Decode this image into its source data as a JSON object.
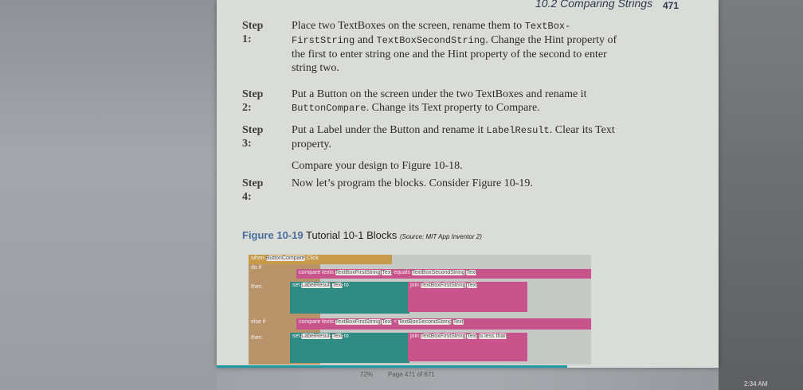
{
  "header": {
    "section": "10.2 Comparing Strings",
    "page": "471"
  },
  "steps": [
    {
      "label": "Step 1:",
      "parts": [
        "Place two TextBoxes on the screen, rename them to ",
        "TextBox-FirstString",
        " and ",
        "TextBoxSecondString",
        ". Change the Hint property of the first to enter string one and the Hint property of the second to enter string two."
      ]
    },
    {
      "label": "Step 2:",
      "parts": [
        "Put a Button on the screen under the two TextBoxes and rename it ",
        "ButtonCompare",
        ". Change its Text property to Compare."
      ]
    },
    {
      "label": "Step 3:",
      "parts": [
        "Put a Label under the Button and rename it ",
        "LabelResult",
        ". Clear its Text property."
      ]
    },
    {
      "label": "",
      "parts": [
        "Compare your design to Figure 10-18."
      ]
    },
    {
      "label": "Step 4:",
      "parts": [
        "Now let’s program the blocks. Consider Figure 10-19."
      ]
    }
  ],
  "figure": {
    "number": "Figure 10-19",
    "title": "Tutorial 10-1 Blocks",
    "source": "(Source: MIT App Inventor 2)"
  },
  "blocks": {
    "when": "when",
    "button": "ButtonCompare",
    "click": "Click",
    "do": "do",
    "if": "if",
    "then": "then",
    "else_if": "else if",
    "compare": "compare texts",
    "first": "TextBoxFirstString",
    "second": "TextBoxSecondString",
    "text": "Text",
    "set": "set",
    "label": "LabelResult",
    "to": "to",
    "join": "join",
    "equals": "equals",
    "lt": "<",
    "less_than": "is less than"
  },
  "status": {
    "zoom": "72%",
    "page": "Page 471 of 671"
  },
  "clock": "2:34 AM"
}
